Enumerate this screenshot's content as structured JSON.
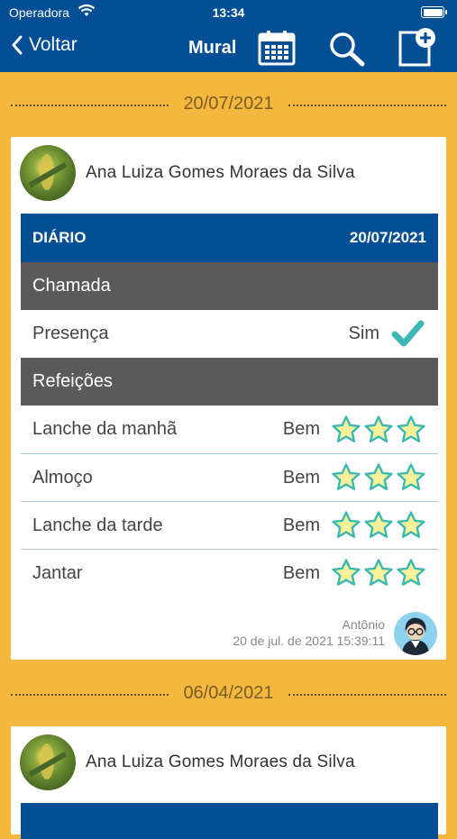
{
  "status_bar": {
    "carrier": "Operadora",
    "time": "13:34"
  },
  "nav": {
    "back_label": "Voltar",
    "title": "Mural"
  },
  "posts": [
    {
      "date": "20/07/2021",
      "student": "Ana Luiza Gomes Moraes da Silva",
      "diary_label": "DIÁRIO",
      "diary_date": "20/07/2021",
      "attendance_section": "Chamada",
      "attendance_label": "Presença",
      "attendance_value": "Sim",
      "meals_section": "Refeições",
      "meals": [
        {
          "label": "Lanche da manhã",
          "value": "Bem",
          "stars": 3
        },
        {
          "label": "Almoço",
          "value": "Bem",
          "stars": 3
        },
        {
          "label": "Lanche da tarde",
          "value": "Bem",
          "stars": 3
        },
        {
          "label": "Jantar",
          "value": "Bem",
          "stars": 3
        }
      ],
      "author": "Antônio",
      "timestamp": "20 de jul. de 2021 15:39:11"
    },
    {
      "date": "06/04/2021",
      "student": "Ana Luiza Gomes Moraes da Silva"
    }
  ],
  "colors": {
    "header_blue": "#034e94",
    "background_yellow": "#f5b83f",
    "section_gray": "#5a5a5a",
    "check_teal": "#3bb8b4",
    "star_fill": "#f7f29a",
    "star_stroke": "#3bb8b4"
  }
}
